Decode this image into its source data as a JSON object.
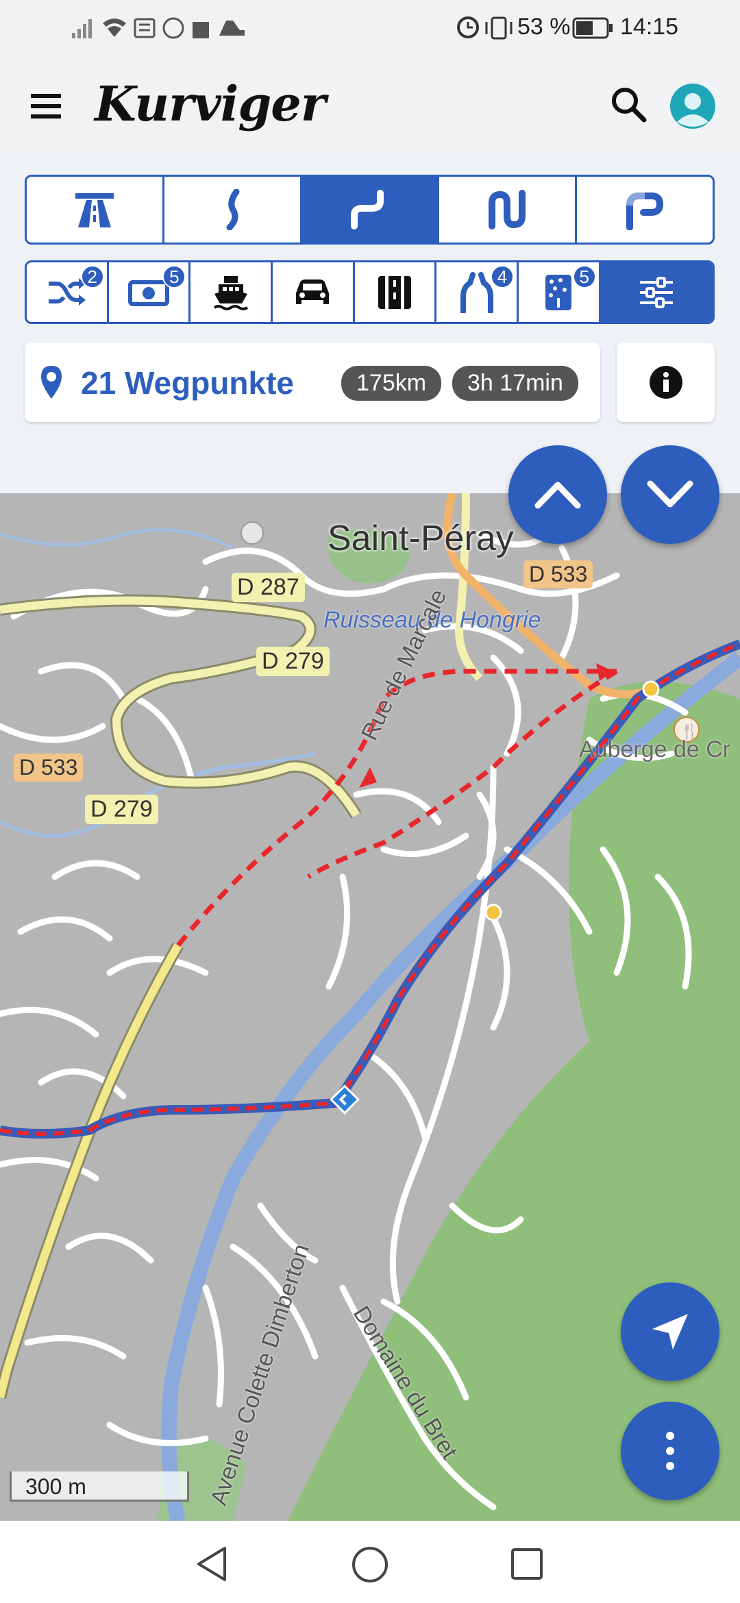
{
  "status_bar": {
    "battery": "53 %",
    "time": "14:15"
  },
  "header": {
    "logo": "Kurviger",
    "search_icon": "search-icon",
    "avatar_icon": "user-avatar-icon"
  },
  "road_types": [
    {
      "name": "highway-icon",
      "active": false
    },
    {
      "name": "curvy-road-icon",
      "active": false
    },
    {
      "name": "curvier-road-icon",
      "active": true
    },
    {
      "name": "very-curvy-road-icon",
      "active": false
    },
    {
      "name": "extreme-curvy-road-icon",
      "active": false
    }
  ],
  "options": [
    {
      "name": "shuffle-icon",
      "badge": "2"
    },
    {
      "name": "toll-icon",
      "badge": "5"
    },
    {
      "name": "ferry-icon",
      "badge": ""
    },
    {
      "name": "car-icon",
      "badge": ""
    },
    {
      "name": "tunnel-icon",
      "badge": ""
    },
    {
      "name": "narrow-road-icon",
      "badge": "4"
    },
    {
      "name": "unpaved-road-icon",
      "badge": "5"
    },
    {
      "name": "settings-sliders-icon",
      "badge": ""
    }
  ],
  "route": {
    "waypoints": "21 Wegpunkte",
    "distance": "175km",
    "duration": "3h 17min"
  },
  "map": {
    "labels": {
      "town": "Saint-Péray",
      "d287": "D 287",
      "d533_right": "D 533",
      "d533_left": "D 533",
      "d279_mid": "D 279",
      "d279_low": "D 279",
      "creek": "Ruisseau de Hongrie",
      "rue_marcale": "Rue de Marcale",
      "avenue": "Avenue Colette Dimberton",
      "domaine": "Domaine du Bret",
      "auberge": "Auberge de Cr"
    },
    "scale": "300 m",
    "colors": {
      "route_red": "#e8262b",
      "route_blue": "#3a5bb8",
      "water": "#8aaadd",
      "forest": "#8fbf7a",
      "urban": "#b9b9b9"
    }
  }
}
